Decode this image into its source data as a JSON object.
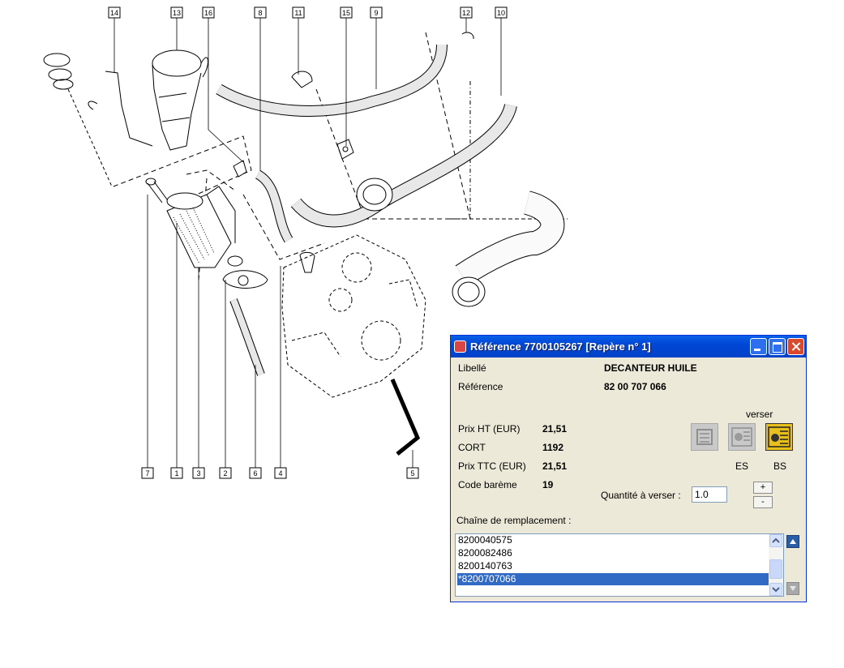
{
  "callouts": [
    "14",
    "13",
    "16",
    "8",
    "11",
    "15",
    "9",
    "12",
    "10",
    "7",
    "1",
    "3",
    "2",
    "6",
    "4",
    "5"
  ],
  "window": {
    "title": "Référence 7700105267 [Repère n° 1]",
    "icons": {
      "app": "app-icon",
      "minimize": "minimize-icon",
      "maximize": "maximize-icon",
      "close": "close-icon"
    }
  },
  "fields": {
    "libelle_label": "Libellé",
    "libelle_value": "DECANTEUR HUILE",
    "reference_label": "Référence",
    "reference_value": "82 00 707 066",
    "prix_ht_label": "Prix HT (EUR)",
    "prix_ht_value": "21,51",
    "cort_label": "CORT",
    "cort_value": "1192",
    "prix_ttc_label": "Prix TTC (EUR)",
    "prix_ttc_value": "21,51",
    "code_bareme_label": "Code barème",
    "code_bareme_value": "19"
  },
  "verser": {
    "title": "verser",
    "es_label": "ES",
    "bs_label": "BS",
    "quantity_label": "Quantité à verser :",
    "quantity_value": "1.0",
    "plus_label": "+",
    "minus_label": "-"
  },
  "chain": {
    "label": "Chaîne de remplacement :",
    "items": [
      "8200040575",
      "8200082486",
      "8200140763",
      "*8200707066"
    ],
    "selected_index": 3
  },
  "colors": {
    "title_bar": "#0046d5",
    "selection": "#316ac5",
    "dialog_bg": "#ece9d8",
    "bs_button": "#e9c01b"
  }
}
